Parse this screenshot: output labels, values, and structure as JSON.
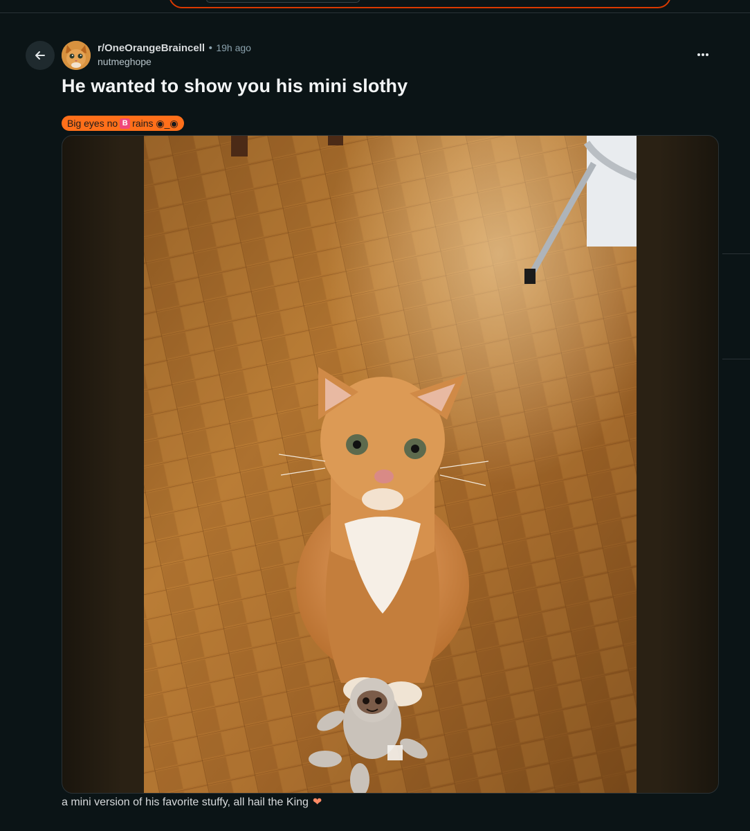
{
  "post": {
    "subreddit": "r/OneOrangeBraincell",
    "separator": "•",
    "time_ago": "19h ago",
    "author": "nutmeghope",
    "title": "He wanted to show you his mini slothy",
    "flair": {
      "text_before": "Big eyes no",
      "emoji": "B",
      "text_after": "rains ◉_◉"
    },
    "caption": "a mini version of his favorite stuffy, all hail the King",
    "caption_emoji": "❤"
  },
  "icons": {
    "back": "arrow-left-icon",
    "more": "more-dots-icon"
  },
  "colors": {
    "background": "#0b1416",
    "flair_bg": "#ff6f1a",
    "accent": "#d93900"
  }
}
